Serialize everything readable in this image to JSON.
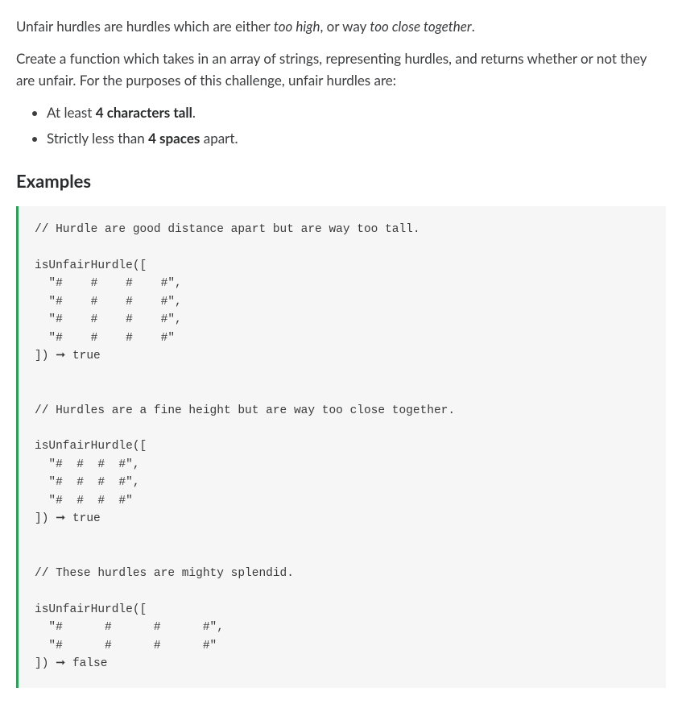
{
  "intro": {
    "p1_parts": [
      "Unfair hurdles are hurdles which are either ",
      "too high",
      ", or way ",
      "too close together",
      "."
    ],
    "p2": "Create a function which takes in an array of strings, representing hurdles, and returns whether or not they are unfair. For the purposes of this challenge, unfair hurdles are:"
  },
  "bullets": [
    {
      "text_before": "At least ",
      "bold": "4 characters tall",
      "text_after": "."
    },
    {
      "text_before": "Strictly less than ",
      "bold": "4 spaces",
      "text_after": " apart."
    }
  ],
  "examples_heading": "Examples",
  "code": "// Hurdle are good distance apart but are way too tall.\n\nisUnfairHurdle([\n  \"#    #    #    #\",\n  \"#    #    #    #\",\n  \"#    #    #    #\",\n  \"#    #    #    #\"\n]) ➞ true\n\n\n// Hurdles are a fine height but are way too close together.\n\nisUnfairHurdle([\n  \"#  #  #  #\",\n  \"#  #  #  #\",\n  \"#  #  #  #\"\n]) ➞ true\n\n\n// These hurdles are mighty splendid.\n\nisUnfairHurdle([\n  \"#      #      #      #\",\n  \"#      #      #      #\"\n]) ➞ false"
}
